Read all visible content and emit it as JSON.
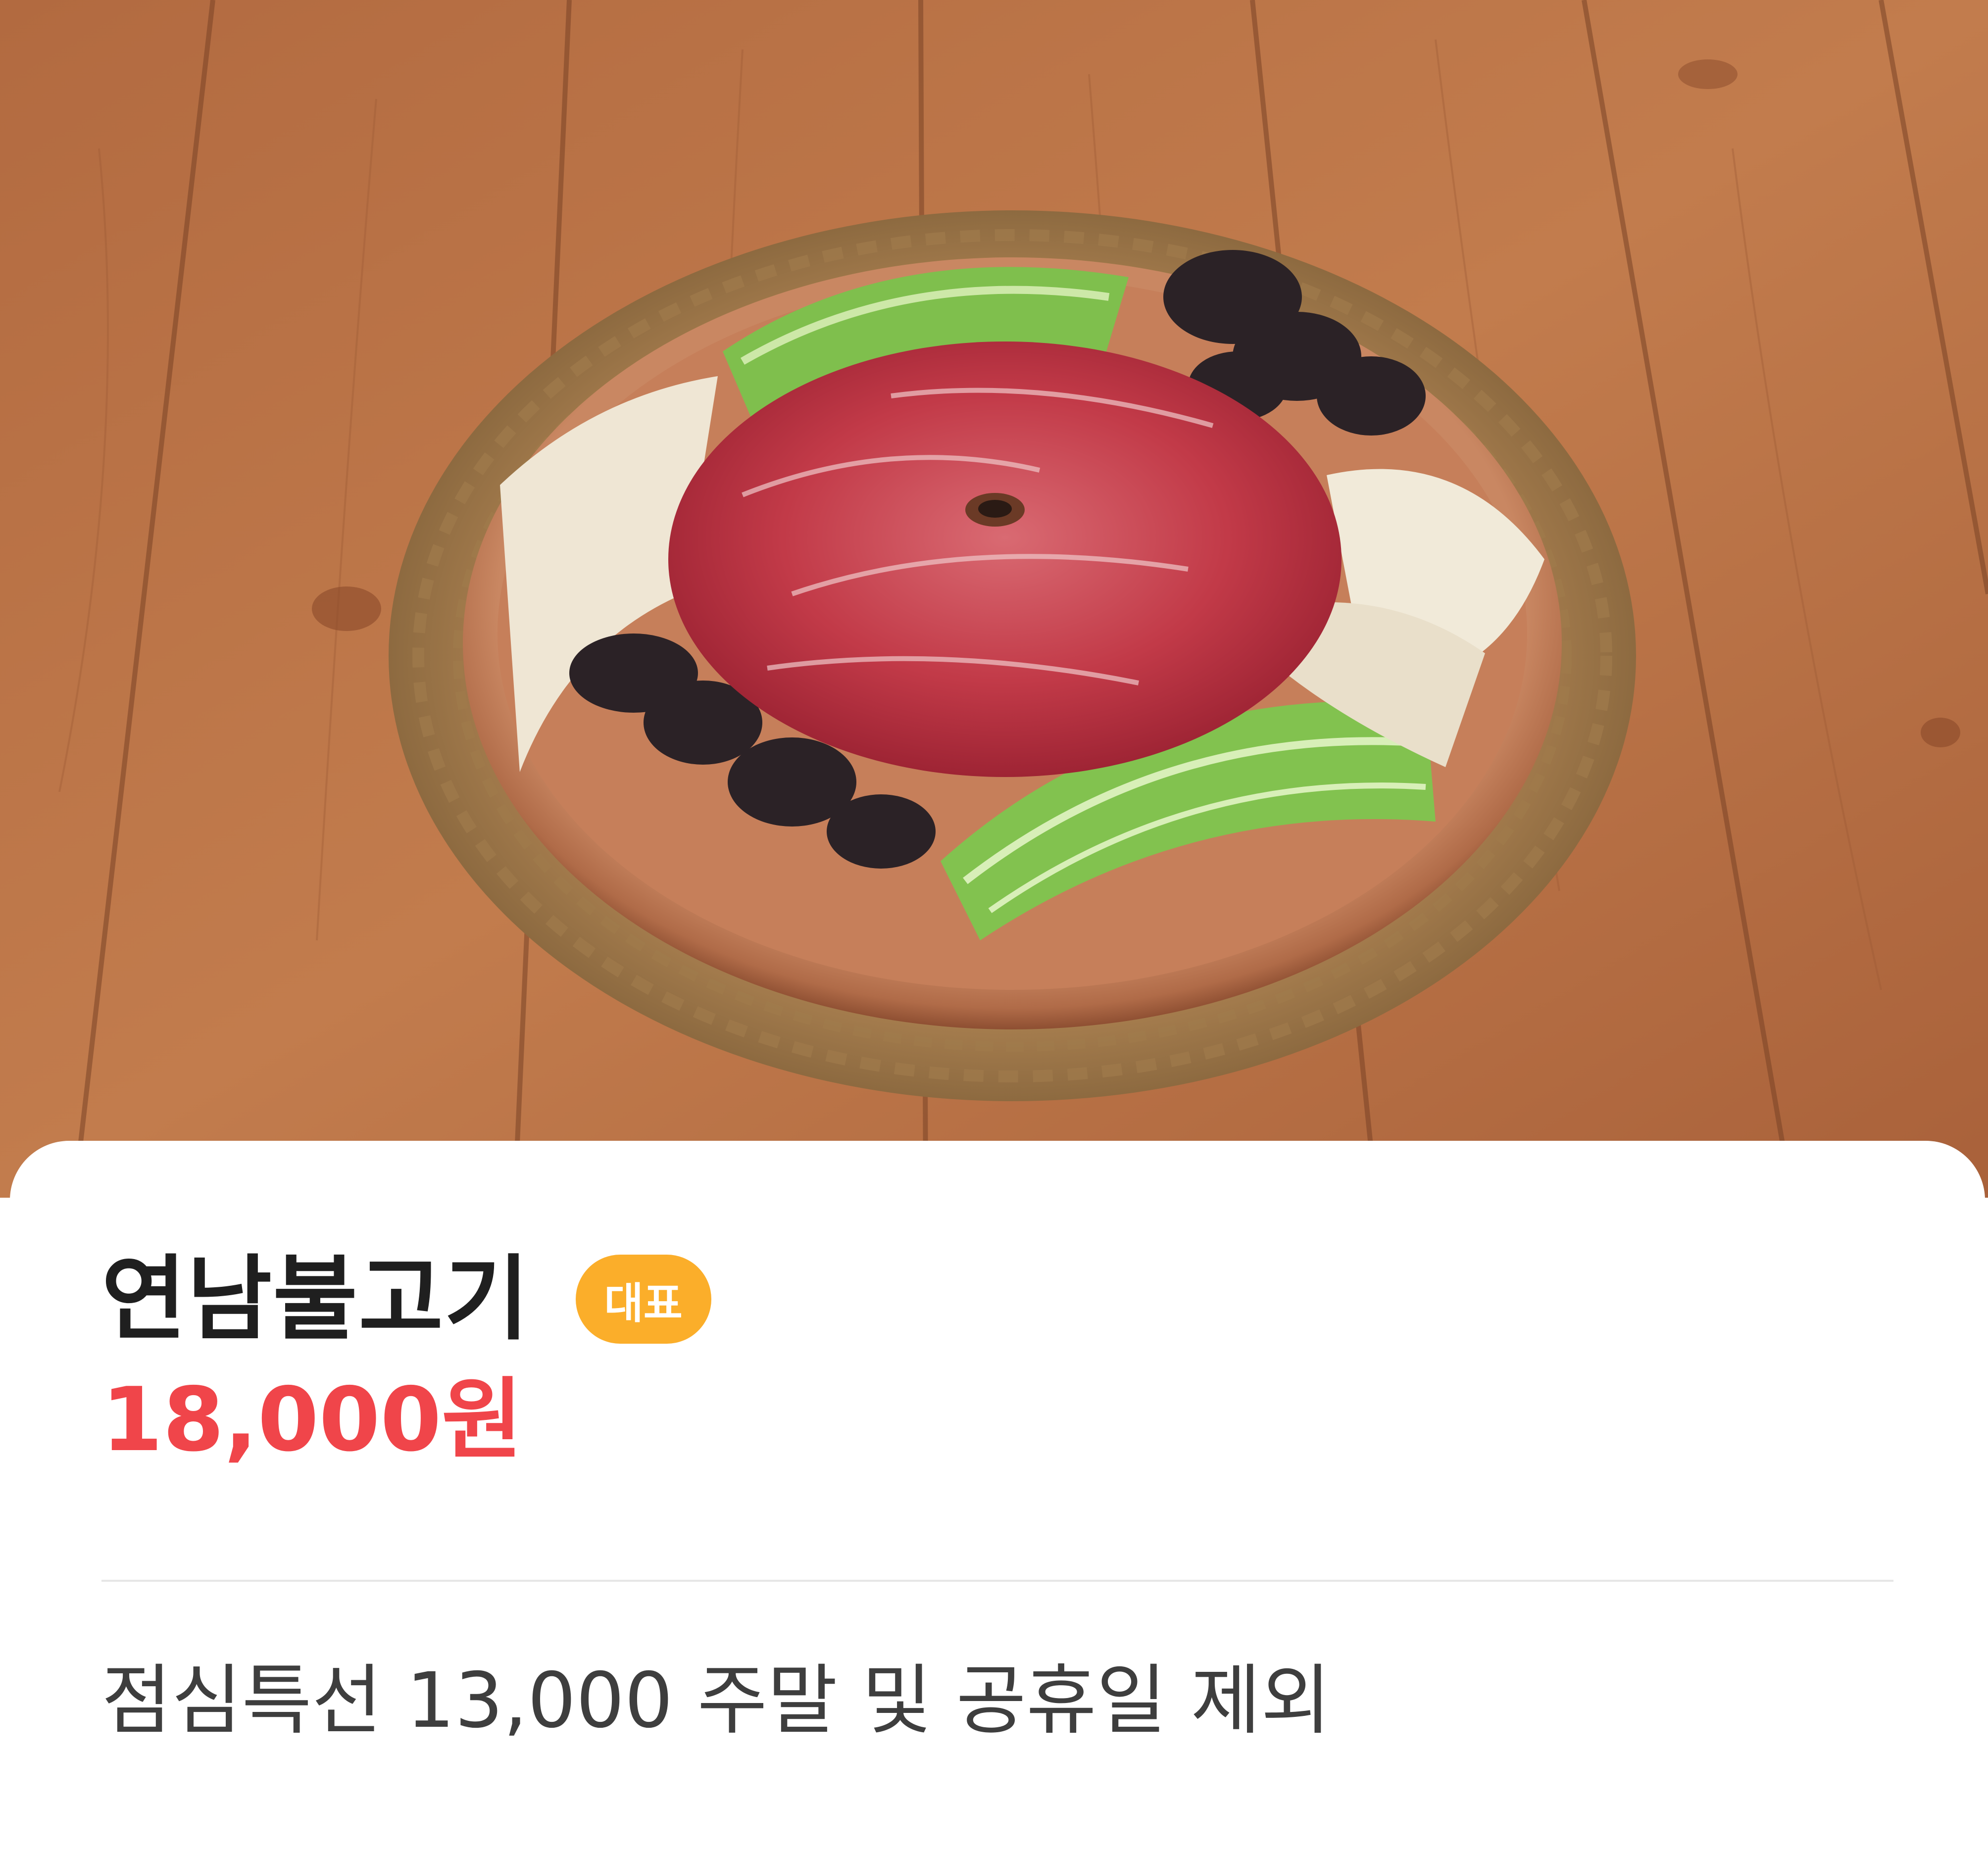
{
  "hero_image": {
    "icon": "bulgogi-dish-photo"
  },
  "menu": {
    "name": "연남불고기",
    "badge": "대표",
    "price": "18,000원",
    "description": "점심특선 13,000 주말 및 공휴일 제외"
  },
  "colors": {
    "badge_bg": "#fbae2a",
    "price": "#f0454a",
    "title": "#1f1f1f",
    "description": "#3e3e3e",
    "divider": "#e6e6e6"
  }
}
